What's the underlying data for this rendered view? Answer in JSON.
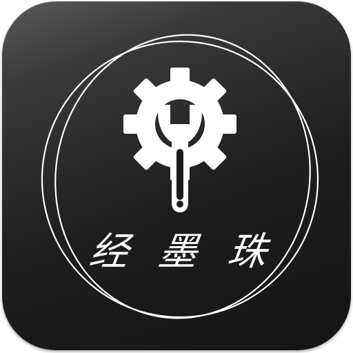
{
  "app_icon": {
    "brand_text": [
      "经",
      "墨",
      "珠"
    ],
    "icon_name": "gear-wrench-icon",
    "colors": {
      "background_top": "#5a5a5a",
      "background_bottom": "#141414",
      "foreground": "#ffffff"
    }
  }
}
